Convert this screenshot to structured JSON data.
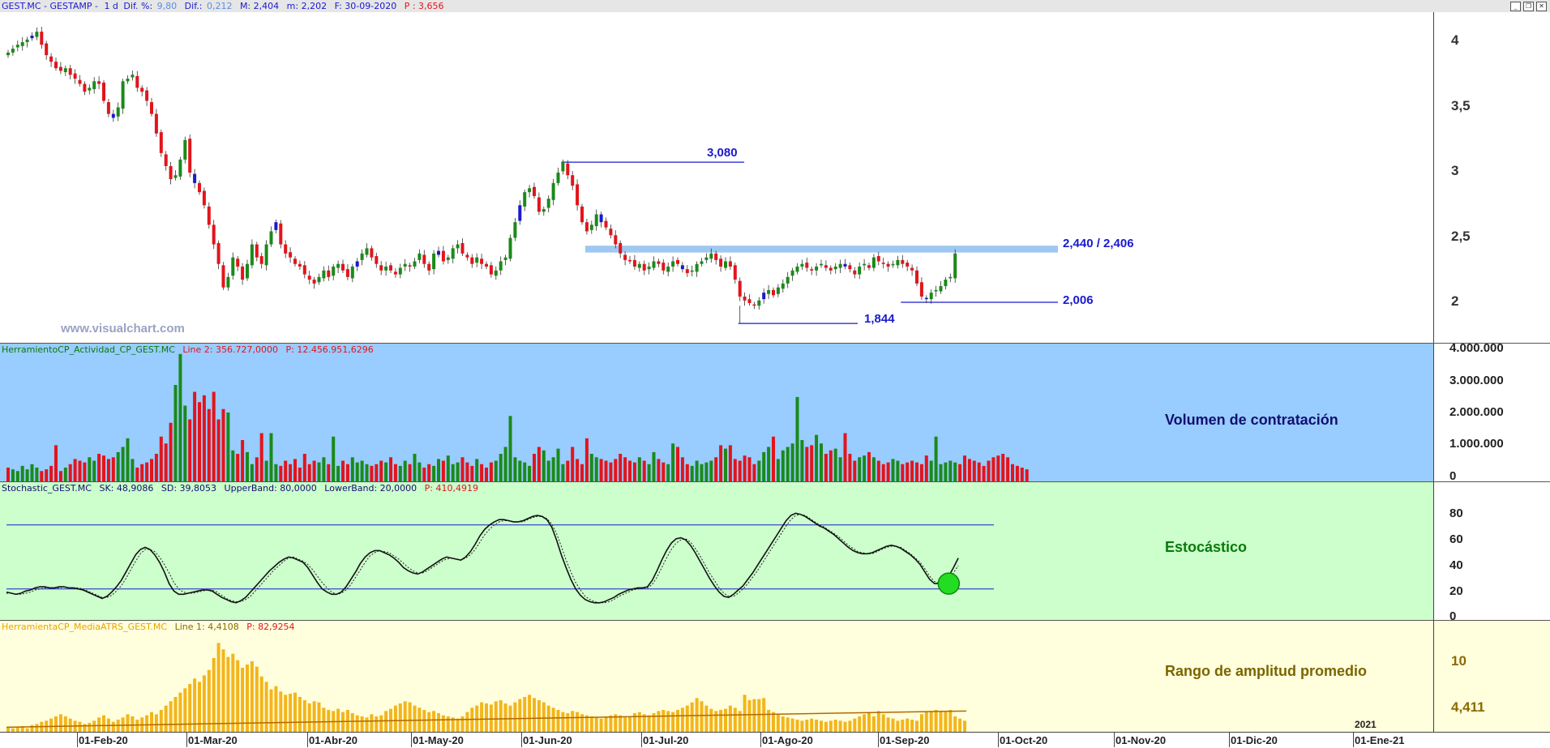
{
  "price_pane": {
    "header": {
      "symbol": "GEST.MC - GESTAMP -",
      "period": "1 d",
      "dif_pct_label": "Dif. %:",
      "dif_pct": "9,80",
      "dif_label": "Dif.:",
      "dif": "0,212",
      "max": "M: 2,404",
      "min": "m: 2,202",
      "date": "F: 30-09-2020",
      "p": "P : 3,656"
    },
    "watermark": "www.visualchart.com",
    "y_ticks": [
      "4",
      "3,5",
      "3",
      "2,5",
      "2"
    ],
    "annotations": {
      "high": "3,080",
      "resistance": "2,440 / 2,406",
      "support": "2,006",
      "low": "1,844"
    },
    "colors": {
      "up": "#1a8a1a",
      "down": "#e3141b",
      "neutral": "#1a1acf",
      "resistance_band": "#9ec8f0"
    }
  },
  "volume_pane": {
    "header": {
      "name": "HerramientoCP_Actividad_CP_GEST.MC",
      "line": "Line 2: 356.727,0000",
      "p": "P: 12.456.951,6296"
    },
    "title": "Volumen de contratación",
    "y_ticks": [
      "4.000.000",
      "3.000.000",
      "2.000.000",
      "1.000.000",
      "0"
    ],
    "background": "#99ccff"
  },
  "stoch_pane": {
    "header": {
      "name": "Stochastic_GEST.MC",
      "sk": "SK: 48,9086",
      "sd": "SD: 39,8053",
      "upper": "UpperBand: 80,0000",
      "lower": "LowerBand: 20,0000",
      "p": "P: 410,4919"
    },
    "title": "Estocástico",
    "y_ticks": [
      "80",
      "60",
      "40",
      "20",
      "0"
    ],
    "background": "#ccffcc"
  },
  "atr_pane": {
    "header": {
      "name": "HerramientaCP_MediaATRS_GEST.MC",
      "line": "Line 1: 4,4108",
      "p": "P: 82,9254"
    },
    "title": "Rango de amplitud promedio",
    "y_ticks": [
      "10"
    ],
    "last_value": "4,411",
    "background": "#ffffdd"
  },
  "x_axis": {
    "labels": [
      "01-Feb-20",
      "01-Mar-20",
      "01-Abr-20",
      "01-May-20",
      "01-Jun-20",
      "01-Jul-20",
      "01-Ago-20",
      "01-Sep-20",
      "01-Oct-20",
      "01-Nov-20",
      "01-Dic-20",
      "01-Ene-21"
    ],
    "year_marker": "2021"
  },
  "chart_data": [
    {
      "type": "candlestick",
      "title": "GEST.MC - GESTAMP",
      "x_start": "2020-01-02",
      "x_end": "2020-09-30",
      "closes": [
        3.92,
        3.95,
        3.98,
        4.0,
        4.02,
        4.05,
        4.08,
        3.98,
        3.9,
        3.85,
        3.8,
        3.78,
        3.8,
        3.75,
        3.72,
        3.68,
        3.62,
        3.65,
        3.7,
        3.68,
        3.55,
        3.45,
        3.42,
        3.5,
        3.7,
        3.72,
        3.75,
        3.65,
        3.62,
        3.55,
        3.45,
        3.3,
        3.15,
        3.05,
        2.95,
        2.98,
        3.1,
        3.25,
        3.0,
        2.92,
        2.85,
        2.75,
        2.6,
        2.45,
        2.3,
        2.12,
        2.2,
        2.35,
        2.28,
        2.18,
        2.3,
        2.45,
        2.35,
        2.3,
        2.45,
        2.55,
        2.62,
        2.45,
        2.38,
        2.35,
        2.3,
        2.28,
        2.22,
        2.18,
        2.15,
        2.2,
        2.25,
        2.2,
        2.28,
        2.3,
        2.25,
        2.2,
        2.28,
        2.32,
        2.38,
        2.42,
        2.35,
        2.3,
        2.25,
        2.28,
        2.25,
        2.22,
        2.27,
        2.3,
        2.28,
        2.32,
        2.38,
        2.3,
        2.25,
        2.38,
        2.4,
        2.32,
        2.35,
        2.42,
        2.45,
        2.38,
        2.35,
        2.3,
        2.35,
        2.3,
        2.28,
        2.22,
        2.25,
        2.32,
        2.35,
        2.5,
        2.62,
        2.75,
        2.85,
        2.88,
        2.82,
        2.7,
        2.72,
        2.8,
        2.92,
        3.0,
        3.08,
        2.98,
        2.9,
        2.75,
        2.62,
        2.55,
        2.6,
        2.68,
        2.62,
        2.58,
        2.52,
        2.45,
        2.38,
        2.33,
        2.32,
        2.28,
        2.3,
        2.25,
        2.28,
        2.32,
        2.3,
        2.25,
        2.28,
        2.32,
        2.3,
        2.26,
        2.23,
        2.25,
        2.3,
        2.32,
        2.35,
        2.38,
        2.33,
        2.28,
        2.32,
        2.28,
        2.18,
        2.05,
        2.02,
        2.0,
        1.98,
        2.02,
        2.08,
        2.1,
        2.06,
        2.12,
        2.15,
        2.2,
        2.25,
        2.28,
        2.3,
        2.27,
        2.25,
        2.28,
        2.3,
        2.27,
        2.25,
        2.28,
        2.3,
        2.28,
        2.26,
        2.22,
        2.28,
        2.3,
        2.27,
        2.35,
        2.32,
        2.3,
        2.28,
        2.3,
        2.33,
        2.3,
        2.28,
        2.25,
        2.15,
        2.05,
        2.03,
        2.08,
        2.1,
        2.13,
        2.18,
        2.2,
        2.38
      ],
      "y_range": [
        1.75,
        4.2
      ],
      "annotations": [
        "3,080",
        "2,440 / 2,406",
        "2,006",
        "1,844"
      ]
    },
    {
      "type": "bar",
      "title": "Volumen de contratación",
      "values": [
        400000,
        350000,
        300000,
        450000,
        350000,
        500000,
        400000,
        300000,
        350000,
        450000,
        1050000,
        300000,
        400000,
        500000,
        650000,
        600000,
        550000,
        700000,
        600000,
        800000,
        750000,
        650000,
        700000,
        850000,
        1000000,
        1250000,
        650000,
        400000,
        500000,
        550000,
        650000,
        800000,
        1300000,
        1100000,
        1700000,
        2800000,
        3700000,
        2200000,
        1800000,
        2600000,
        2300000,
        2500000,
        2100000,
        2600000,
        1800000,
        2100000,
        2000000,
        900000,
        800000,
        1200000,
        850000,
        500000,
        700000,
        1400000,
        600000,
        1400000,
        500000,
        450000,
        600000,
        500000,
        650000,
        400000,
        800000,
        500000,
        600000,
        550000,
        700000,
        500000,
        1300000,
        450000,
        600000,
        500000,
        700000,
        550000,
        600000,
        500000,
        450000,
        500000,
        600000,
        550000,
        700000,
        500000,
        450000,
        600000,
        500000,
        800000,
        550000,
        400000,
        500000,
        450000,
        650000,
        600000,
        750000,
        500000,
        550000,
        700000,
        550000,
        450000,
        650000,
        500000,
        400000,
        550000,
        600000,
        800000,
        1000000,
        1900000,
        700000,
        600000,
        550000,
        450000,
        800000,
        1000000,
        900000,
        600000,
        700000,
        950000,
        500000,
        600000,
        1000000,
        650000,
        500000,
        1250000,
        800000,
        700000,
        650000,
        600000,
        550000,
        650000,
        800000,
        700000,
        600000,
        550000,
        700000,
        600000,
        500000,
        850000,
        650000,
        550000,
        500000,
        1100000,
        1000000,
        700000,
        500000,
        450000,
        600000,
        500000,
        550000,
        600000,
        700000,
        1050000,
        950000,
        1050000,
        650000,
        600000,
        750000,
        700000,
        500000,
        600000,
        850000,
        1000000,
        1300000,
        650000,
        900000,
        1000000,
        1100000,
        2450000,
        1200000,
        1000000,
        1050000,
        1350000,
        1100000,
        800000,
        900000,
        950000,
        700000,
        1400000,
        800000,
        600000,
        700000,
        750000,
        850000,
        700000,
        600000,
        500000,
        550000,
        650000,
        600000,
        500000,
        550000,
        600000,
        550000,
        500000,
        750000,
        600000,
        1300000,
        500000,
        550000,
        600000,
        550000,
        500000,
        750000,
        650000,
        600000,
        550000,
        450000,
        600000,
        700000,
        750000,
        800000,
        700000,
        500000,
        450000,
        400000,
        350000
      ],
      "y_range": [
        0,
        4000000
      ]
    },
    {
      "type": "line",
      "title": "Estocástico",
      "series": [
        {
          "name": "SK",
          "values": [
            17,
            16,
            15,
            16,
            18,
            19,
            21,
            22,
            22,
            21,
            21,
            22,
            22,
            21,
            21,
            20,
            19,
            17,
            15,
            13,
            11,
            13,
            17,
            22,
            28,
            36,
            44,
            52,
            57,
            59,
            57,
            52,
            45,
            36,
            25,
            18,
            15,
            15,
            16,
            17,
            18,
            19,
            19,
            18,
            15,
            12,
            10,
            8,
            7,
            9,
            12,
            17,
            22,
            27,
            32,
            37,
            41,
            45,
            48,
            50,
            49,
            47,
            45,
            40,
            33,
            26,
            20,
            17,
            15,
            15,
            17,
            22,
            29,
            36,
            44,
            50,
            54,
            56,
            56,
            54,
            52,
            49,
            45,
            40,
            37,
            35,
            34,
            36,
            39,
            42,
            45,
            48,
            50,
            49,
            48,
            47,
            50,
            55,
            62,
            70,
            76,
            80,
            83,
            85,
            85,
            84,
            83,
            83,
            84,
            86,
            88,
            89,
            88,
            85,
            78,
            66,
            52,
            40,
            29,
            20,
            14,
            10,
            8,
            7,
            7,
            8,
            10,
            12,
            15,
            17,
            19,
            20,
            21,
            21,
            22,
            28,
            37,
            47,
            56,
            63,
            67,
            68,
            66,
            61,
            54,
            46,
            38,
            30,
            23,
            17,
            13,
            12,
            15,
            19,
            23,
            29,
            35,
            42,
            49,
            56,
            63,
            70,
            77,
            84,
            89,
            91,
            90,
            88,
            85,
            82,
            79,
            77,
            74,
            71,
            67,
            63,
            59,
            56,
            54,
            53,
            53,
            54,
            56,
            58,
            60,
            61,
            60,
            58,
            55,
            52,
            48,
            43,
            36,
            29,
            25,
            25,
            27,
            32,
            40,
            49
          ]
        },
        {
          "name": "SD",
          "values": [
            16,
            16,
            15,
            15,
            16,
            17,
            19,
            20,
            21,
            21,
            21,
            21,
            22,
            21,
            21,
            21,
            20,
            18,
            16,
            14,
            12,
            12,
            14,
            18,
            23,
            30,
            38,
            46,
            53,
            57,
            57,
            55,
            50,
            43,
            35,
            26,
            20,
            17,
            16,
            16,
            17,
            18,
            19,
            19,
            17,
            14,
            11,
            9,
            8,
            8,
            10,
            13,
            18,
            23,
            28,
            33,
            38,
            42,
            46,
            49,
            50,
            48,
            46,
            43,
            38,
            32,
            26,
            21,
            17,
            15,
            16,
            19,
            24,
            31,
            38,
            45,
            51,
            54,
            56,
            55,
            54,
            51,
            48,
            44,
            40,
            37,
            35,
            35,
            37,
            40,
            43,
            46,
            48,
            49,
            48,
            47,
            49,
            52,
            57,
            64,
            71,
            76,
            80,
            83,
            84,
            84,
            83,
            83,
            83,
            85,
            87,
            88,
            88,
            86,
            81,
            72,
            60,
            47,
            36,
            26,
            19,
            13,
            10,
            8,
            7,
            7,
            8,
            10,
            13,
            15,
            17,
            19,
            20,
            21,
            21,
            24,
            31,
            40,
            49,
            57,
            63,
            66,
            67,
            64,
            58,
            51,
            43,
            35,
            28,
            21,
            16,
            13,
            13,
            16,
            20,
            25,
            31,
            37,
            44,
            51,
            58,
            65,
            72,
            79,
            85,
            89,
            90,
            89,
            86,
            83,
            80,
            78,
            75,
            72,
            69,
            65,
            61,
            58,
            55,
            54,
            53,
            53,
            55,
            57,
            59,
            60,
            60,
            59,
            56,
            53,
            49,
            45,
            39,
            32,
            27,
            25,
            26,
            29,
            35,
            42
          ]
        }
      ],
      "bands": [
        80,
        20
      ],
      "y_range": [
        0,
        100
      ]
    },
    {
      "type": "bar",
      "title": "Rango de amplitud promedio",
      "values": [
        4.0,
        3.9,
        4.0,
        4.1,
        3.9,
        4.2,
        4.3,
        4.5,
        4.6,
        4.8,
        5.0,
        5.2,
        5.0,
        4.8,
        4.6,
        4.5,
        4.3,
        4.4,
        4.6,
        4.9,
        5.1,
        4.8,
        4.5,
        4.7,
        4.9,
        5.2,
        5.0,
        4.7,
        4.9,
        5.1,
        5.4,
        5.2,
        5.6,
        6.0,
        6.4,
        6.8,
        7.2,
        7.6,
        8.0,
        8.5,
        8.2,
        8.8,
        9.3,
        10.4,
        11.8,
        11.2,
        10.5,
        10.8,
        10.2,
        9.5,
        9.8,
        10.1,
        9.6,
        8.7,
        8.2,
        7.5,
        7.8,
        7.3,
        7.0,
        7.1,
        7.2,
        6.8,
        6.5,
        6.2,
        6.4,
        6.3,
        5.8,
        5.6,
        5.5,
        5.7,
        5.4,
        5.6,
        5.3,
        5.1,
        5.0,
        4.9,
        5.2,
        5.0,
        5.1,
        5.5,
        5.7,
        6.0,
        6.2,
        6.4,
        6.3,
        6.0,
        5.8,
        5.6,
        5.4,
        5.5,
        5.3,
        5.1,
        5.0,
        4.9,
        4.8,
        5.0,
        5.4,
        5.8,
        6.0,
        6.3,
        6.2,
        6.1,
        6.4,
        6.5,
        6.2,
        6.0,
        6.3,
        6.6,
        6.8,
        7.0,
        6.7,
        6.5,
        6.3,
        6.0,
        5.8,
        5.6,
        5.4,
        5.3,
        5.5,
        5.4,
        5.2,
        5.1,
        5.0,
        4.9,
        4.8,
        5.0,
        5.1,
        5.2,
        5.1,
        4.9,
        5.0,
        5.3,
        5.4,
        5.2,
        5.1,
        5.3,
        5.5,
        5.6,
        5.5,
        5.4,
        5.6,
        5.8,
        6.0,
        6.3,
        6.7,
        6.4,
        6.0,
        5.7,
        5.5,
        5.6,
        5.7,
        6.0,
        5.8,
        5.5,
        7.0,
        6.5,
        6.6,
        6.6,
        6.7,
        5.6,
        5.4,
        5.2,
        5.0,
        4.9,
        4.8,
        4.7,
        4.6,
        4.7,
        4.8,
        4.7,
        4.6,
        4.5,
        4.6,
        4.7,
        4.6,
        4.5,
        4.6,
        4.8,
        5.0,
        5.2,
        5.4,
        5.0,
        5.5,
        5.2,
        4.9,
        4.8,
        4.6,
        4.7,
        4.8,
        4.7,
        4.6,
        5.2,
        5.4,
        5.5,
        5.6,
        5.5,
        5.4,
        5.6,
        5.0,
        4.8,
        4.6
      ],
      "moving_average": {
        "start": 4.0,
        "end": 5.5
      },
      "y_range": [
        3.5,
        12.5
      ]
    }
  ]
}
